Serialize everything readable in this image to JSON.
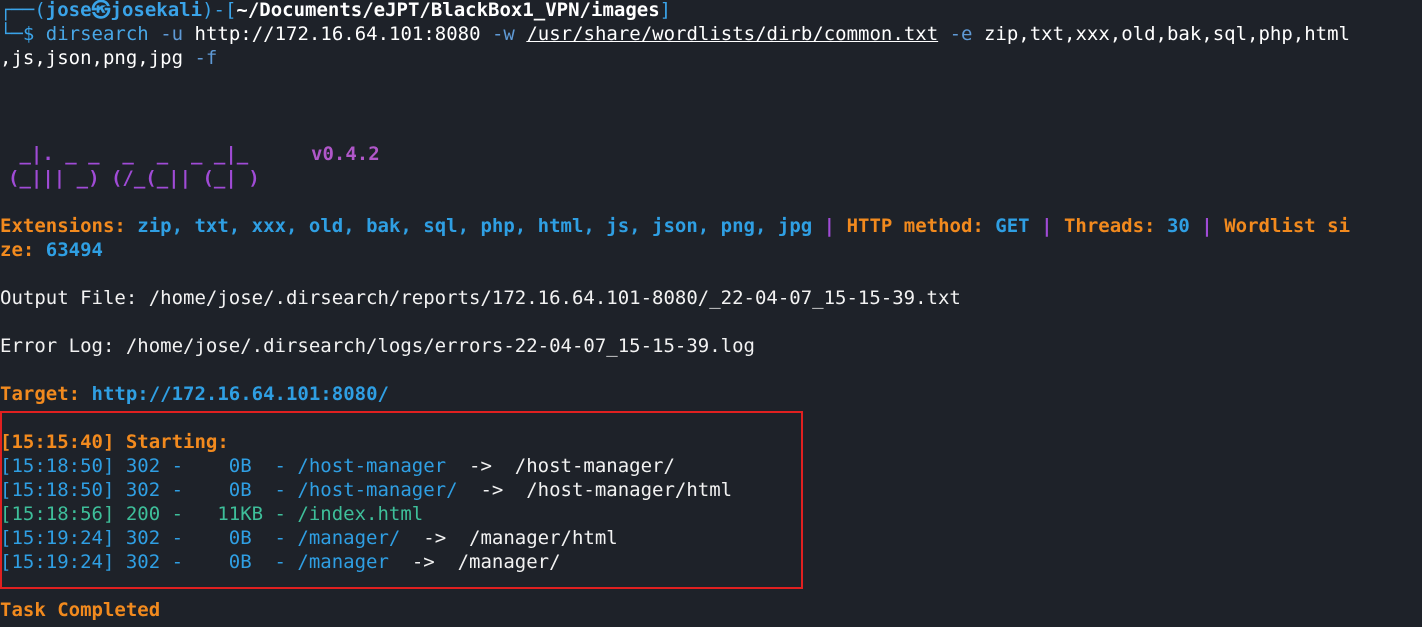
{
  "prompt": {
    "open": "┌──(",
    "user": "jose",
    "at": "㉿",
    "host": "josekali",
    "mid": ")-[",
    "cwd": "~/Documents/eJPT/BlackBox1_VPN/images",
    "close": "]",
    "corner": "└─",
    "dollar": "$"
  },
  "command": {
    "program": "dirsearch",
    "flag_u": "-u",
    "url": "http://172.16.64.101:8080",
    "flag_w": "-w",
    "wordlist": "/usr/share/wordlists/dirb/common.txt",
    "flag_e": "-e",
    "ext_part1": "zip,txt,xxx,old,bak,sql,php,html",
    "ext_part2": ",js,json,png,jpg",
    "flag_f": "-f"
  },
  "banner": {
    "logo_line1": " _|. _ _  _  _  _ _|_",
    "logo_line2": "(_||| _) (/_(_|| (_| )",
    "version": "v0.4.2"
  },
  "config": {
    "ext_label": "Extensions:",
    "ext_value": "zip, txt, xxx, old, bak, sql, php, html, js, json, png, jpg",
    "sep": "|",
    "method_label": "HTTP method:",
    "method_value": "GET",
    "threads_label": "Threads:",
    "threads_value": "30",
    "wordlist_label_part1": "Wordlist si",
    "wordlist_label_part2": "ze:",
    "wordlist_value": "63494"
  },
  "output_file": "Output File: /home/jose/.dirsearch/reports/172.16.64.101-8080/_22-04-07_15-15-39.txt",
  "error_log": "Error Log: /home/jose/.dirsearch/logs/errors-22-04-07_15-15-39.log",
  "target": {
    "label": "Target:",
    "value": "http://172.16.64.101:8080/"
  },
  "results": {
    "starting": "[15:15:40] Starting:",
    "rows": [
      {
        "head": "[15:18:50] 302 -    0B  - /host-manager",
        "tail": "  ->  /host-manager/",
        "status": "redirect"
      },
      {
        "head": "[15:18:50] 302 -    0B  - /host-manager/",
        "tail": "  ->  /host-manager/html",
        "status": "redirect"
      },
      {
        "head": "[15:18:56] 200 -   11KB - /index.html",
        "tail": "",
        "status": "ok"
      },
      {
        "head": "[15:19:24] 302 -    0B  - /manager/",
        "tail": "  ->  /manager/html",
        "status": "redirect"
      },
      {
        "head": "[15:19:24] 302 -    0B  - /manager",
        "tail": "  ->  /manager/",
        "status": "redirect"
      }
    ]
  },
  "task_completed": "Task Completed",
  "colors": {
    "background": "#1e2229",
    "redirect": "#2f9fe3",
    "ok": "#3ebf9a",
    "highlight_box": "#e02020"
  }
}
